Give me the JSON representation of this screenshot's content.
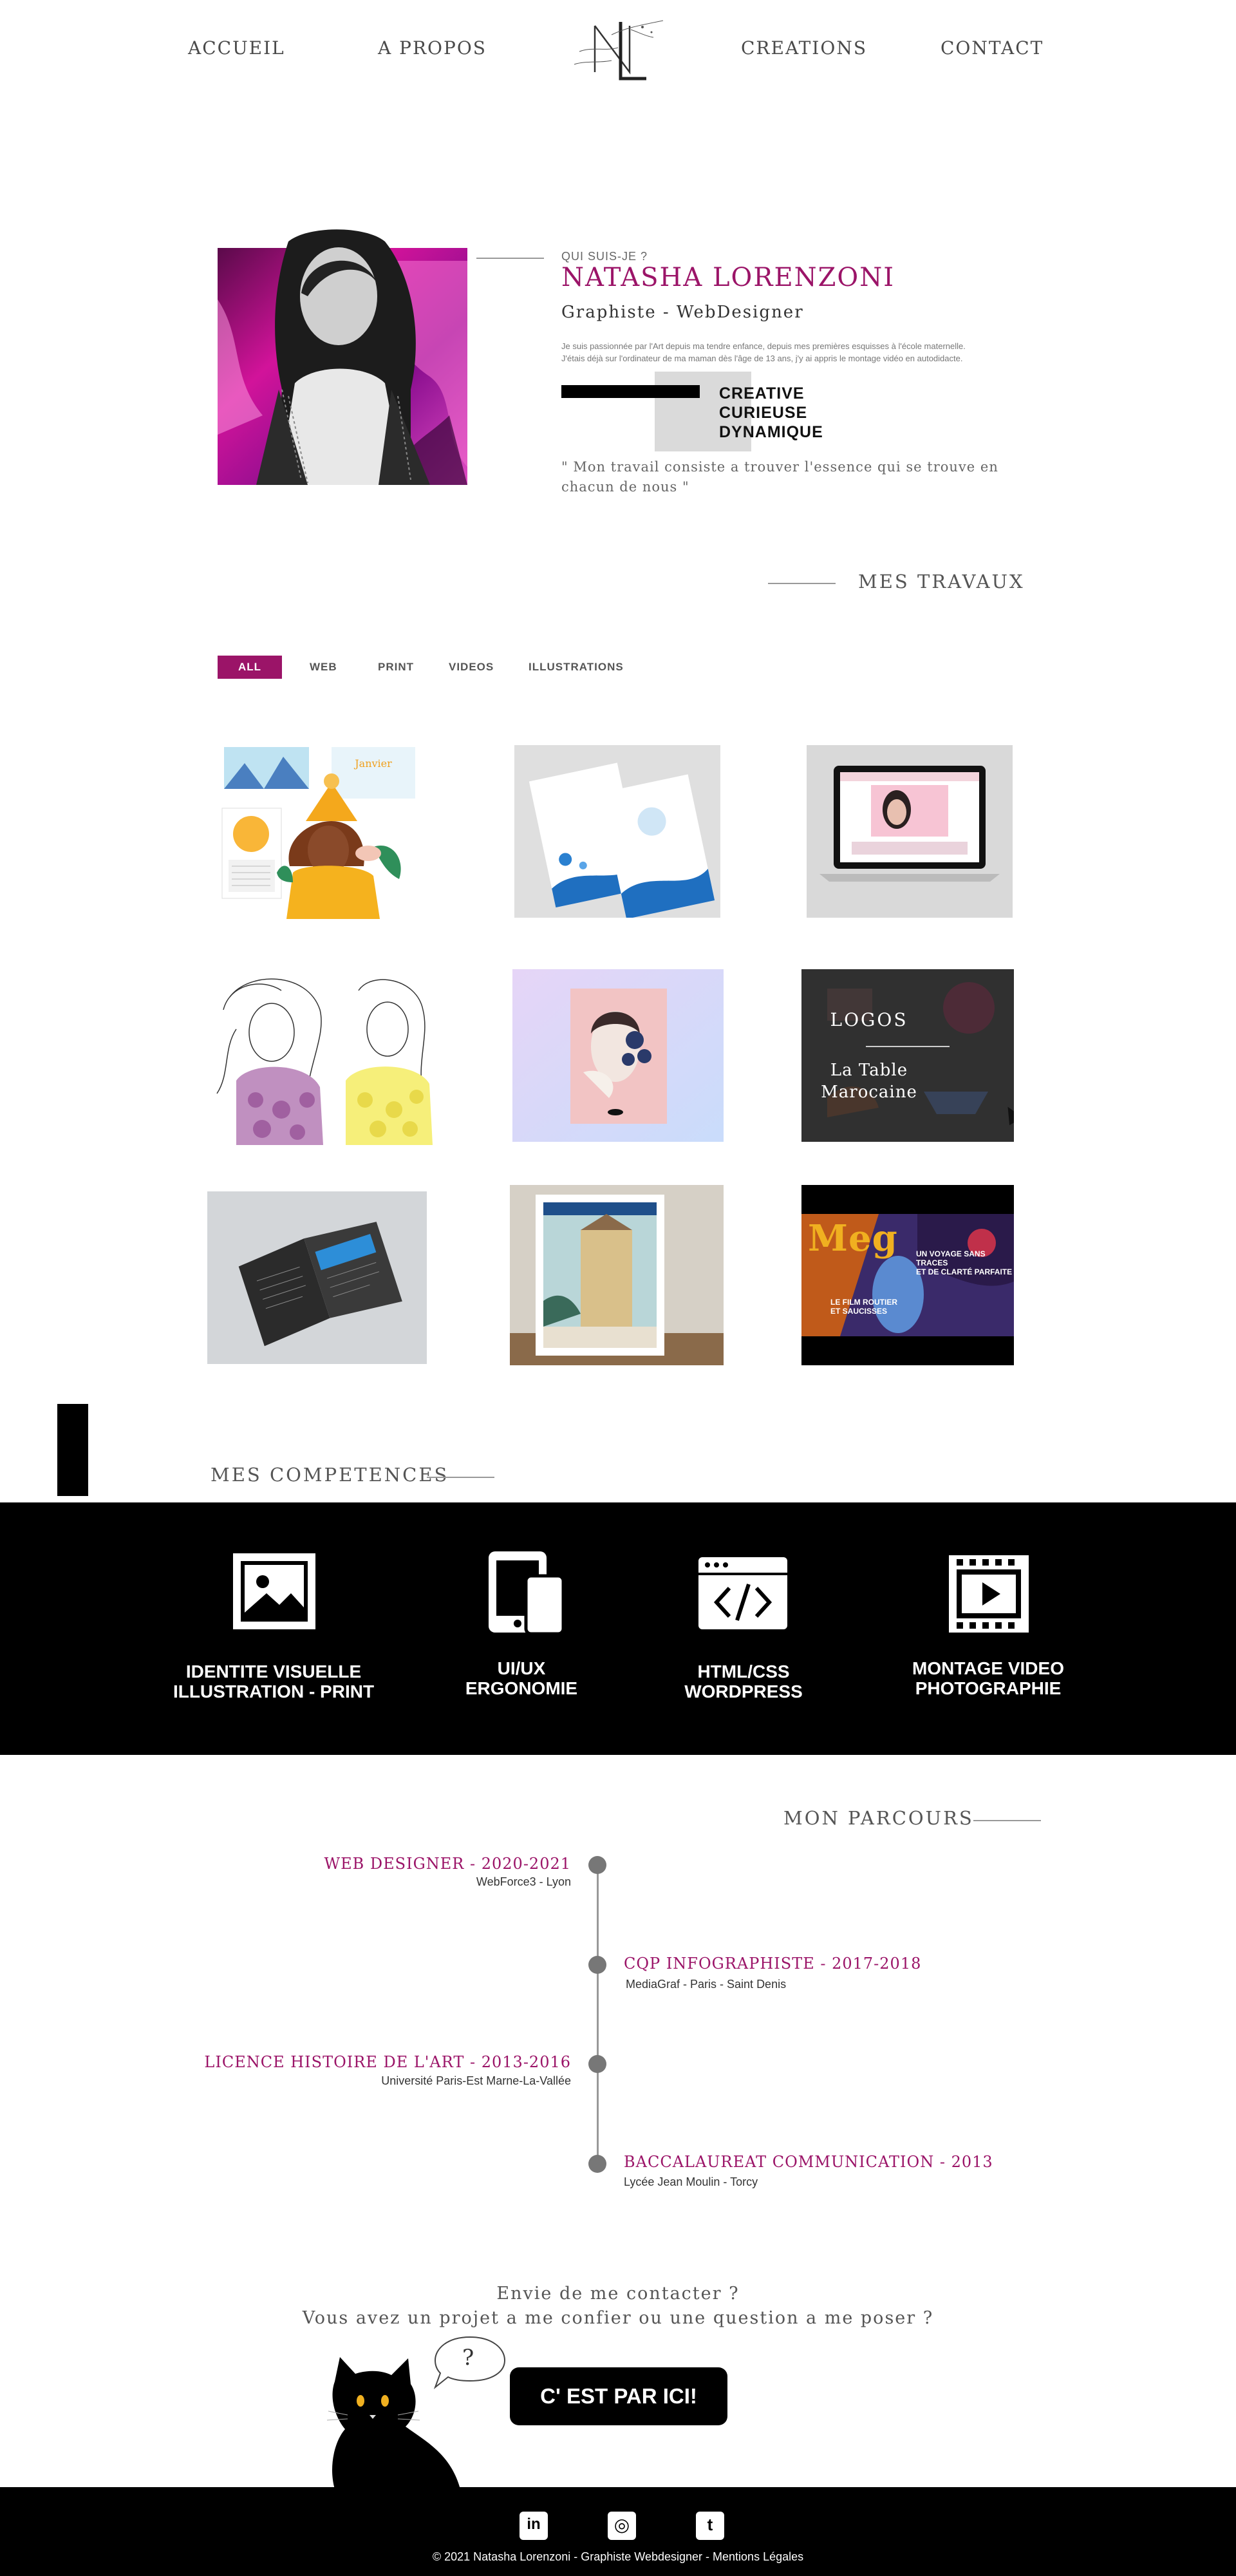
{
  "nav": {
    "items": [
      "ACCUEIL",
      "A PROPOS",
      "CREATIONS",
      "CONTACT"
    ]
  },
  "about": {
    "kicker": "QUI SUIS-JE ?",
    "name": "NATASHA LORENZONI",
    "role": "Graphiste - WebDesigner",
    "intro_line1": "Je suis passionnée par l'Art depuis ma tendre enfance, depuis mes premières esquisses à l'école maternelle.",
    "intro_line2": "J'étais déjà sur l'ordinateur de ma maman dès l'âge de 13 ans, j'y ai appris le montage vidéo en autodidacte.",
    "traits": [
      "CREATIVE",
      "CURIEUSE",
      "DYNAMIQUE"
    ],
    "quote": "\" Mon travail consiste a trouver l'essence qui se trouve en chacun de nous \""
  },
  "works": {
    "title": "MES TRAVAUX",
    "filters": [
      "ALL",
      "WEB",
      "PRINT",
      "VIDEOS",
      "ILLUSTRATIONS"
    ],
    "active_filter": "ALL",
    "hover_card": {
      "label": "LOGOS",
      "project_line1": "La Table",
      "project_line2": "Marocaine"
    },
    "video_text": {
      "brand": "Meg",
      "line1": "UN VOYAGE SANS TRACES",
      "line2": "ET DE CLARTÉ PARFAITE",
      "line3": "LE FILM ROUTIER",
      "line4": "ET SAUCISSES"
    }
  },
  "skills": {
    "title": "MES COMPETENCES",
    "items": [
      {
        "icon": "image-icon",
        "line1": "IDENTITE VISUELLE",
        "line2": "ILLUSTRATION - PRINT"
      },
      {
        "icon": "devices-icon",
        "line1": "UI/UX",
        "line2": "ERGONOMIE"
      },
      {
        "icon": "code-window-icon",
        "line1": "HTML/CSS",
        "line2": "WORDPRESS"
      },
      {
        "icon": "film-play-icon",
        "line1": "MONTAGE VIDEO",
        "line2": "PHOTOGRAPHIE"
      }
    ]
  },
  "journey": {
    "title": "MON PARCOURS",
    "entries": [
      {
        "title": "WEB DESIGNER - 2020-2021",
        "place": "WebForce3 - Lyon"
      },
      {
        "title": "CQP INFOGRAPHISTE - 2017-2018",
        "place": "MediaGraf - Paris - Saint Denis"
      },
      {
        "title": "LICENCE HISTOIRE DE L'ART - 2013-2016",
        "place": "Université Paris-Est Marne-La-Vallée"
      },
      {
        "title": "BACCALAUREAT COMMUNICATION - 2013",
        "place": "Lycée Jean Moulin - Torcy"
      }
    ]
  },
  "contact": {
    "line1": "Envie de me contacter ?",
    "line2": "Vous avez un projet a me confier ou une question a me poser ?",
    "bubble": "?",
    "cta": "C' EST PAR ICI!"
  },
  "footer": {
    "social": [
      "linkedin-icon",
      "instagram-icon",
      "tumblr-icon"
    ],
    "social_glyphs": [
      "in",
      "◎",
      "t"
    ],
    "copyright": "© 2021 Natasha Lorenzoni - Graphiste Webdesigner - Mentions Légales"
  },
  "colors": {
    "accent": "#9b1468",
    "dark": "#000000",
    "grey": "#dadada"
  }
}
